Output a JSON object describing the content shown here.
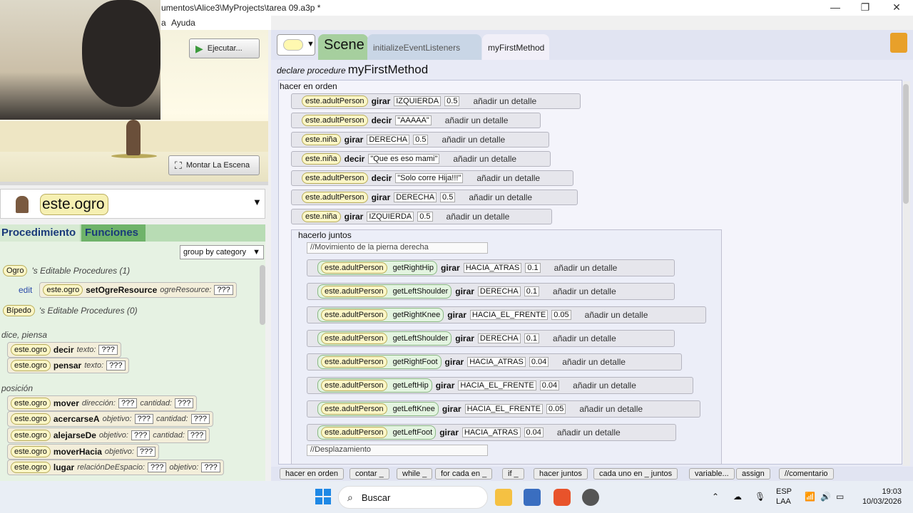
{
  "window": {
    "title": "umentos\\Alice3\\MyProjects\\tarea 09.a3p *",
    "min": "—",
    "max": "❐",
    "close": "✕"
  },
  "menu": [
    "a",
    "Ayuda"
  ],
  "scene": {
    "run_label": "Ejecutar...",
    "mount_label": "Montar La Escena"
  },
  "object_selector": {
    "value": "este.ogro"
  },
  "tabs": {
    "procedures": "Procedimiento",
    "functions": "Funciones"
  },
  "palette": {
    "group_by": "group by category",
    "ogro_class": "Ogro",
    "ogro_header": "'s Editable Procedures (1)",
    "edit_label": "edit",
    "edit_target": "este.ogro",
    "edit_method": "setOgreResource",
    "edit_param": "ogreResource:",
    "qmark": "???",
    "biped_class": "Bípedo",
    "biped_header": "'s Editable Procedures (0)",
    "say_section": "dice, piensa",
    "say": {
      "obj": "este.ogro",
      "method": "decir",
      "param": "texto:"
    },
    "think": {
      "obj": "este.ogro",
      "method": "pensar",
      "param": "texto:"
    },
    "pos_section": "posición",
    "move": {
      "obj": "este.ogro",
      "method": "mover",
      "p1": "dirección:",
      "p2": "cantidad:"
    },
    "toward": {
      "obj": "este.ogro",
      "method": "acercarseA",
      "p1": "objetivo:",
      "p2": "cantidad:"
    },
    "away": {
      "obj": "este.ogro",
      "method": "alejarseDe",
      "p1": "objetivo:",
      "p2": "cantidad:"
    },
    "moveto": {
      "obj": "este.ogro",
      "method": "moverHacia",
      "p1": "objetivo:"
    },
    "place": {
      "obj": "este.ogro",
      "method": "lugar",
      "p1": "relaciónDeEspacio:",
      "p2": "objetivo:"
    }
  },
  "editor": {
    "tab_scene": "Scene",
    "tab_init": "initializeEventListeners",
    "tab_method": "myFirstMethod",
    "declare": "declare procedure",
    "method_name": "myFirstMethod",
    "seq_label": "hacer en orden",
    "add_detail": "añadir un detalle",
    "statements": [
      {
        "obj": "este.adultPerson",
        "verb": "girar",
        "a1": "IZQUIERDA",
        "a2": "0.5"
      },
      {
        "obj": "este.adultPerson",
        "verb": "decir",
        "a1": "\"AAAAA\"",
        "a2": ""
      },
      {
        "obj": "este.niña",
        "verb": "girar",
        "a1": "DERECHA",
        "a2": "0.5"
      },
      {
        "obj": "este.niña",
        "verb": "decir",
        "a1": "\"Que es eso mami\"",
        "a2": ""
      },
      {
        "obj": "este.adultPerson",
        "verb": "decir",
        "a1": "\"Solo corre Hija!!!\"",
        "a2": ""
      },
      {
        "obj": "este.adultPerson",
        "verb": "girar",
        "a1": "DERECHA",
        "a2": "0.5"
      },
      {
        "obj": "este.niña",
        "verb": "girar",
        "a1": "IZQUIERDA",
        "a2": "0.5"
      }
    ],
    "together_label": "hacerlo juntos",
    "comment1": "//Movimiento de la pierna derecha",
    "joints": [
      {
        "obj": "este.adultPerson",
        "joint": "getRightHip",
        "dir": "HACIA_ATRAS",
        "amt": "0.1"
      },
      {
        "obj": "este.adultPerson",
        "joint": "getLeftShoulder",
        "dir": "DERECHA",
        "amt": "0.1"
      },
      {
        "obj": "este.adultPerson",
        "joint": "getRightKnee",
        "dir": "HACIA_EL_FRENTE",
        "amt": "0.05"
      },
      {
        "obj": "este.adultPerson",
        "joint": "getLeftShoulder",
        "dir": "DERECHA",
        "amt": "0.1"
      },
      {
        "obj": "este.adultPerson",
        "joint": "getRightFoot",
        "dir": "HACIA_ATRAS",
        "amt": "0.04"
      },
      {
        "obj": "este.adultPerson",
        "joint": "getLeftHip",
        "dir": "HACIA_EL_FRENTE",
        "amt": "0.04"
      },
      {
        "obj": "este.adultPerson",
        "joint": "getLeftKnee",
        "dir": "HACIA_EL_FRENTE",
        "amt": "0.05"
      },
      {
        "obj": "este.adultPerson",
        "joint": "getLeftFoot",
        "dir": "HACIA_ATRAS",
        "amt": "0.04"
      }
    ],
    "joint_verb": "girar",
    "comment2": "//Desplazamiento"
  },
  "footer": [
    "hacer en orden",
    "contar _",
    "while _",
    "for cada en _",
    "if _",
    "hacer juntos",
    "cada uno en _ juntos",
    "variable...",
    "assign",
    "//comentario"
  ],
  "taskbar": {
    "search": "Buscar",
    "lang1": "ESP",
    "lang2": "LAA",
    "time": "19:03",
    "date": "10/03/2026"
  }
}
